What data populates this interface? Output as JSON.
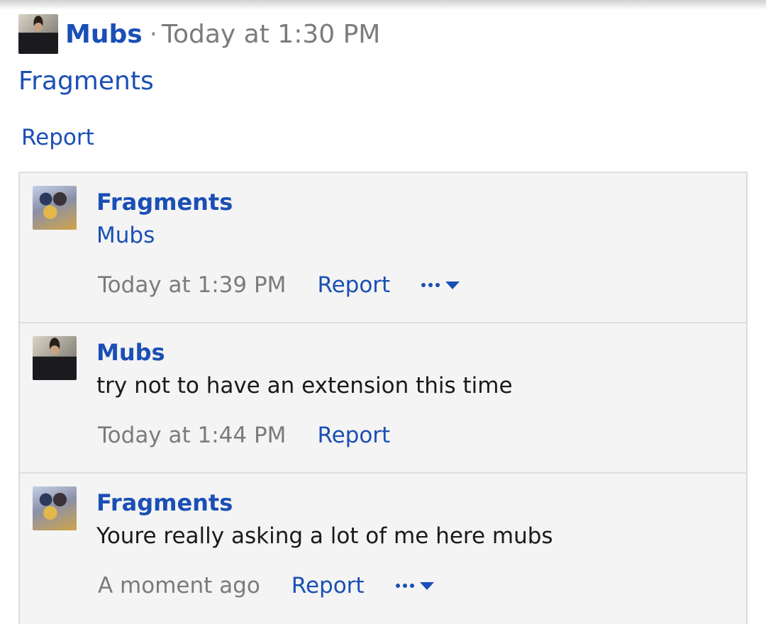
{
  "post": {
    "author": "Mubs",
    "separator": "·",
    "time": "Today at 1:30 PM",
    "title": "Fragments",
    "report_label": "Report"
  },
  "comments": [
    {
      "author": "Fragments",
      "body": "Mubs",
      "time": "Today at 1:39 PM",
      "report_label": "Report",
      "has_more_menu": true
    },
    {
      "author": "Mubs",
      "body": "try not to have an extension this time",
      "time": "Today at 1:44 PM",
      "report_label": "Report",
      "has_more_menu": false
    },
    {
      "author": "Fragments",
      "body": "Youre really asking a lot of me here mubs",
      "time": "A moment ago",
      "report_label": "Report",
      "has_more_menu": true
    }
  ],
  "colors": {
    "link": "#1a4fb5",
    "muted": "#7b7b7b",
    "panel_bg": "#f4f4f4",
    "border": "#dddddd"
  },
  "icons": {
    "more": "more-dots-icon",
    "caret": "caret-down-icon"
  }
}
